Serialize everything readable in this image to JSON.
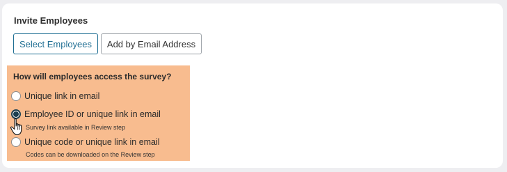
{
  "invite": {
    "title": "Invite Employees",
    "buttons": {
      "select_employees": "Select Employees",
      "add_by_email": "Add by Email Address"
    }
  },
  "access": {
    "question": "How will employees access the survey?",
    "options": [
      {
        "label": "Unique link in email",
        "hint": "",
        "selected": false
      },
      {
        "label": "Employee ID or unique link in email",
        "hint": "Survey link available in Review step",
        "selected": true
      },
      {
        "label": "Unique code or unique link in email",
        "hint": "Codes can be downloaded on the Review step",
        "selected": false
      }
    ]
  },
  "colors": {
    "panel_highlight": "#f8bc8f",
    "accent": "#1f6e93",
    "radio_checked": "#1c3f4f"
  },
  "icons": {
    "cursor": "hand-pointer-icon"
  }
}
